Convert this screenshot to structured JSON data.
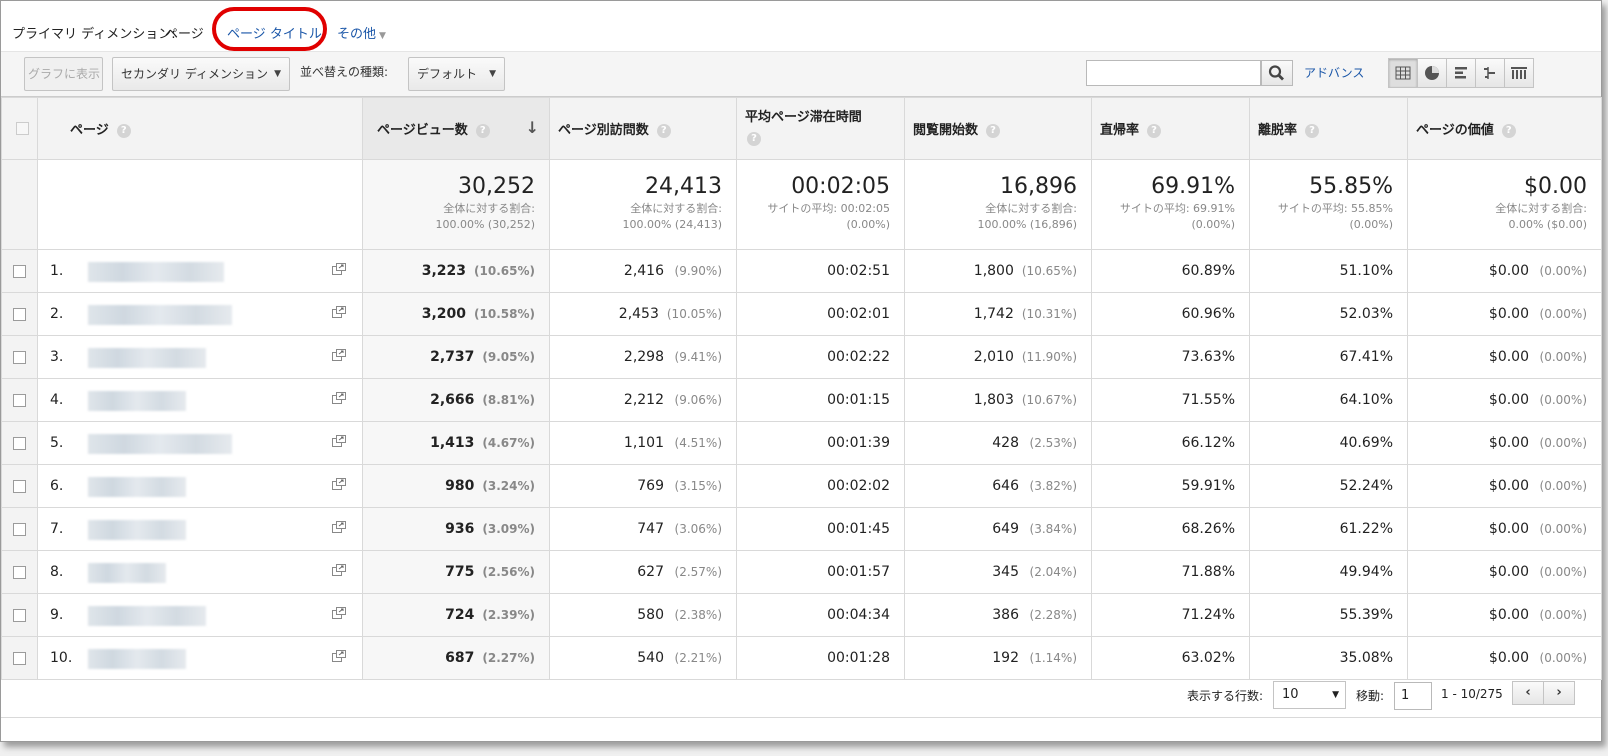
{
  "dimensions": {
    "label": "プライマリ ディメンション:",
    "current": "ページ",
    "options": [
      "ページ タイトル",
      "その他"
    ]
  },
  "toolbar": {
    "chart_btn": "グラフに表示",
    "secondary_dim": "セカンダリ ディメンション",
    "sort_label": "並べ替えの種類:",
    "sort_value": "デフォルト",
    "search_value": "",
    "advanced": "アドバンス",
    "view_icons": [
      "grid-view-icon",
      "pie-view-icon",
      "bar-view-icon",
      "compare-view-icon",
      "pivot-view-icon"
    ]
  },
  "columns": [
    "ページ",
    "ページビュー数",
    "ページ別訪問数",
    "平均ページ滞在時間",
    "閲覧開始数",
    "直帰率",
    "離脱率",
    "ページの価値"
  ],
  "totals": [
    {
      "value": "30,252",
      "sub1": "全体に対する割合:",
      "sub2": "100.00% (30,252)"
    },
    {
      "value": "24,413",
      "sub1": "全体に対する割合:",
      "sub2": "100.00% (24,413)"
    },
    {
      "value": "00:02:05",
      "sub1": "サイトの平均: 00:02:05",
      "sub2": "(0.00%)"
    },
    {
      "value": "16,896",
      "sub1": "全体に対する割合:",
      "sub2": "100.00% (16,896)"
    },
    {
      "value": "69.91%",
      "sub1": "サイトの平均: 69.91%",
      "sub2": "(0.00%)"
    },
    {
      "value": "55.85%",
      "sub1": "サイトの平均: 55.85%",
      "sub2": "(0.00%)"
    },
    {
      "value": "$0.00",
      "sub1": "全体に対する割合:",
      "sub2": "0.00% ($0.00)"
    }
  ],
  "rows": [
    {
      "num": "1.",
      "pv": "3,223",
      "pv_pct": "(10.65%)",
      "uv": "2,416",
      "uv_pct": "(9.90%)",
      "avg": "00:02:51",
      "ent": "1,800",
      "ent_pct": "(10.65%)",
      "bounce": "60.89%",
      "exit": "51.10%",
      "val": "$0.00",
      "val_pct": "(0.00%)"
    },
    {
      "num": "2.",
      "pv": "3,200",
      "pv_pct": "(10.58%)",
      "uv": "2,453",
      "uv_pct": "(10.05%)",
      "avg": "00:02:01",
      "ent": "1,742",
      "ent_pct": "(10.31%)",
      "bounce": "60.96%",
      "exit": "52.03%",
      "val": "$0.00",
      "val_pct": "(0.00%)"
    },
    {
      "num": "3.",
      "pv": "2,737",
      "pv_pct": "(9.05%)",
      "uv": "2,298",
      "uv_pct": "(9.41%)",
      "avg": "00:02:22",
      "ent": "2,010",
      "ent_pct": "(11.90%)",
      "bounce": "73.63%",
      "exit": "67.41%",
      "val": "$0.00",
      "val_pct": "(0.00%)"
    },
    {
      "num": "4.",
      "pv": "2,666",
      "pv_pct": "(8.81%)",
      "uv": "2,212",
      "uv_pct": "(9.06%)",
      "avg": "00:01:15",
      "ent": "1,803",
      "ent_pct": "(10.67%)",
      "bounce": "71.55%",
      "exit": "64.10%",
      "val": "$0.00",
      "val_pct": "(0.00%)"
    },
    {
      "num": "5.",
      "pv": "1,413",
      "pv_pct": "(4.67%)",
      "uv": "1,101",
      "uv_pct": "(4.51%)",
      "avg": "00:01:39",
      "ent": "428",
      "ent_pct": "(2.53%)",
      "bounce": "66.12%",
      "exit": "40.69%",
      "val": "$0.00",
      "val_pct": "(0.00%)"
    },
    {
      "num": "6.",
      "pv": "980",
      "pv_pct": "(3.24%)",
      "uv": "769",
      "uv_pct": "(3.15%)",
      "avg": "00:02:02",
      "ent": "646",
      "ent_pct": "(3.82%)",
      "bounce": "59.91%",
      "exit": "52.24%",
      "val": "$0.00",
      "val_pct": "(0.00%)"
    },
    {
      "num": "7.",
      "pv": "936",
      "pv_pct": "(3.09%)",
      "uv": "747",
      "uv_pct": "(3.06%)",
      "avg": "00:01:45",
      "ent": "649",
      "ent_pct": "(3.84%)",
      "bounce": "68.26%",
      "exit": "61.22%",
      "val": "$0.00",
      "val_pct": "(0.00%)"
    },
    {
      "num": "8.",
      "pv": "775",
      "pv_pct": "(2.56%)",
      "uv": "627",
      "uv_pct": "(2.57%)",
      "avg": "00:01:57",
      "ent": "345",
      "ent_pct": "(2.04%)",
      "bounce": "71.88%",
      "exit": "49.94%",
      "val": "$0.00",
      "val_pct": "(0.00%)"
    },
    {
      "num": "9.",
      "pv": "724",
      "pv_pct": "(2.39%)",
      "uv": "580",
      "uv_pct": "(2.38%)",
      "avg": "00:04:34",
      "ent": "386",
      "ent_pct": "(2.28%)",
      "bounce": "71.24%",
      "exit": "55.39%",
      "val": "$0.00",
      "val_pct": "(0.00%)"
    },
    {
      "num": "10.",
      "pv": "687",
      "pv_pct": "(2.27%)",
      "uv": "540",
      "uv_pct": "(2.21%)",
      "avg": "00:01:28",
      "ent": "192",
      "ent_pct": "(1.14%)",
      "bounce": "63.02%",
      "exit": "35.08%",
      "val": "$0.00",
      "val_pct": "(0.00%)"
    }
  ],
  "pager": {
    "rows_label": "表示する行数:",
    "rows_value": "10",
    "goto_label": "移動:",
    "goto_value": "1",
    "range": "1 - 10/275",
    "prev": "‹",
    "next": "›"
  },
  "colors": {
    "link": "#1a56a8",
    "highlight_oval": "#e00000"
  }
}
